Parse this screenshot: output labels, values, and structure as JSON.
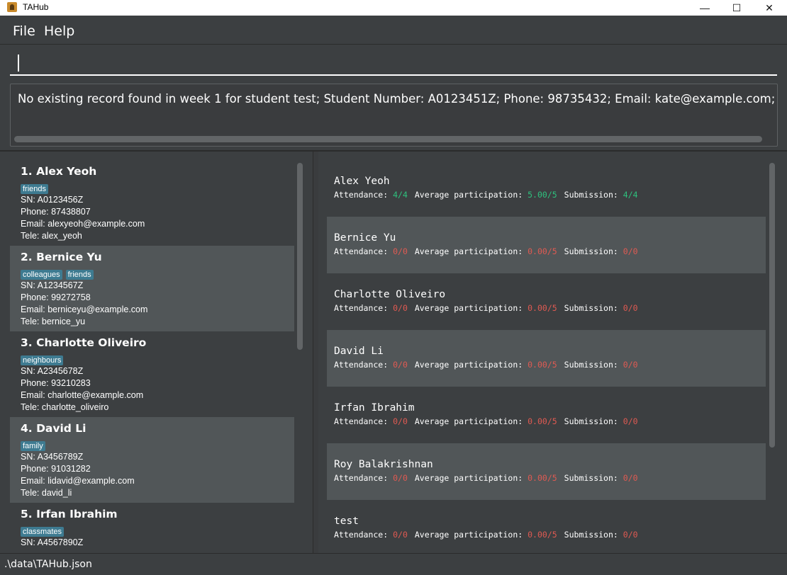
{
  "window": {
    "title": "TAHub",
    "minimize": "—",
    "maximize": "☐",
    "close": "✕"
  },
  "menu": {
    "file": "File",
    "help": "Help"
  },
  "command": {
    "value": ""
  },
  "result": {
    "text": "No existing record found in week 1 for student test; Student Number: A0123451Z; Phone: 98735432; Email: kate@example.com; Telegram: abc; Tags: "
  },
  "persons": [
    {
      "name": "1. Alex Yeoh",
      "tags": [
        "friends"
      ],
      "sn": "SN: A0123456Z",
      "phone": "Phone: 87438807",
      "email": "Email: alexyeoh@example.com",
      "tele": "Tele: alex_yeoh"
    },
    {
      "name": "2. Bernice Yu",
      "tags": [
        "colleagues",
        "friends"
      ],
      "sn": "SN: A1234567Z",
      "phone": "Phone: 99272758",
      "email": "Email: berniceyu@example.com",
      "tele": "Tele: bernice_yu"
    },
    {
      "name": "3. Charlotte Oliveiro",
      "tags": [
        "neighbours"
      ],
      "sn": "SN: A2345678Z",
      "phone": "Phone: 93210283",
      "email": "Email: charlotte@example.com",
      "tele": "Tele: charlotte_oliveiro"
    },
    {
      "name": "4. David Li",
      "tags": [
        "family"
      ],
      "sn": "SN: A3456789Z",
      "phone": "Phone: 91031282",
      "email": "Email: lidavid@example.com",
      "tele": "Tele: david_li"
    },
    {
      "name": "5. Irfan Ibrahim",
      "tags": [
        "classmates"
      ],
      "sn": "SN: A4567890Z",
      "phone": "",
      "email": "",
      "tele": ""
    }
  ],
  "stats_labels": {
    "attendance": "Attendance: ",
    "participation": "Average participation: ",
    "submission": "Submission: "
  },
  "stats": [
    {
      "name": "Alex Yeoh",
      "attendance": "4/4",
      "participation": "5.00/5",
      "submission": "4/4",
      "good": true
    },
    {
      "name": "Bernice Yu",
      "attendance": "0/0",
      "participation": "0.00/5",
      "submission": "0/0",
      "good": false
    },
    {
      "name": "Charlotte Oliveiro",
      "attendance": "0/0",
      "participation": "0.00/5",
      "submission": "0/0",
      "good": false
    },
    {
      "name": "David Li",
      "attendance": "0/0",
      "participation": "0.00/5",
      "submission": "0/0",
      "good": false
    },
    {
      "name": "Irfan Ibrahim",
      "attendance": "0/0",
      "participation": "0.00/5",
      "submission": "0/0",
      "good": false
    },
    {
      "name": "Roy Balakrishnan",
      "attendance": "0/0",
      "participation": "0.00/5",
      "submission": "0/0",
      "good": false
    },
    {
      "name": "test",
      "attendance": "0/0",
      "participation": "0.00/5",
      "submission": "0/0",
      "good": false
    }
  ],
  "status": {
    "path": ".\\data\\TAHub.json"
  },
  "colors": {
    "good": "#2ec27e",
    "bad": "#e05a52",
    "tag": "#3e7b91"
  }
}
